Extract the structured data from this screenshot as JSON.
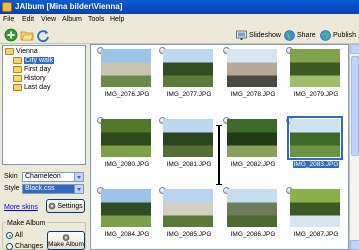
{
  "window": {
    "title": "JAlbum [Mina bilder\\Vienna]"
  },
  "menu": [
    "File",
    "Edit",
    "View",
    "Album",
    "Tools",
    "Help"
  ],
  "toolbar": {
    "slideshow_label": "Slideshow",
    "share_label": "Share",
    "publish_label": "Publish"
  },
  "tree": {
    "root": "Vienna",
    "items": [
      "City walk",
      "First day",
      "History",
      "Last day"
    ],
    "selected": "City walk"
  },
  "skin": {
    "label": "Skin",
    "value": "Chameleon"
  },
  "style": {
    "label": "Style",
    "value": "Black.css"
  },
  "settings_label": "Settings",
  "more_skins_label": "More skins",
  "make_album": {
    "title": "Make Album",
    "option_all": "All",
    "option_changes": "Changes",
    "button_label": "Make Album"
  },
  "thumbnails": [
    {
      "name": "IMG_2076.JPG",
      "selected": false,
      "palette": [
        "#9cc3e8",
        "#c9c3b3",
        "#6b8a4a"
      ]
    },
    {
      "name": "IMG_2077.JPG",
      "selected": false,
      "palette": [
        "#bcd8f0",
        "#2f4d22",
        "#5c7a3a"
      ]
    },
    {
      "name": "IMG_2078.JPG",
      "selected": false,
      "palette": [
        "#d8e6f3",
        "#b8a898",
        "#4a4a42"
      ]
    },
    {
      "name": "IMG_2079.JPG",
      "selected": false,
      "palette": [
        "#7fa24a",
        "#3c5a24",
        "#9fbe6a"
      ]
    },
    {
      "name": "IMG_2080.JPG",
      "selected": false,
      "palette": [
        "#4f7a2c",
        "#2f4a1a",
        "#7da048"
      ]
    },
    {
      "name": "IMG_2081.JPG",
      "selected": false,
      "palette": [
        "#bcd8f0",
        "#2a4420",
        "#556e36"
      ]
    },
    {
      "name": "IMG_2082.JPG",
      "selected": false,
      "palette": [
        "#3b6a2a",
        "#1f3a14",
        "#8aa05a"
      ]
    },
    {
      "name": "IMG_2083.JPG",
      "selected": true,
      "palette": [
        "#cfe3f3",
        "#3d6a2a",
        "#6a9440"
      ]
    },
    {
      "name": "IMG_2084.JPG",
      "selected": false,
      "palette": [
        "#9cc3e8",
        "#2f4d22",
        "#7da048"
      ]
    },
    {
      "name": "IMG_2085.JPG",
      "selected": false,
      "palette": [
        "#b9d4ee",
        "#d4d0c4",
        "#5a7a3a"
      ]
    },
    {
      "name": "IMG_2086.JPG",
      "selected": false,
      "palette": [
        "#c8dcf0",
        "#6e7c5a",
        "#4a6a30"
      ]
    },
    {
      "name": "IMG_2087.JPG",
      "selected": false,
      "palette": [
        "#8ab04a",
        "#3c5a24",
        "#d8e6f3"
      ]
    }
  ]
}
